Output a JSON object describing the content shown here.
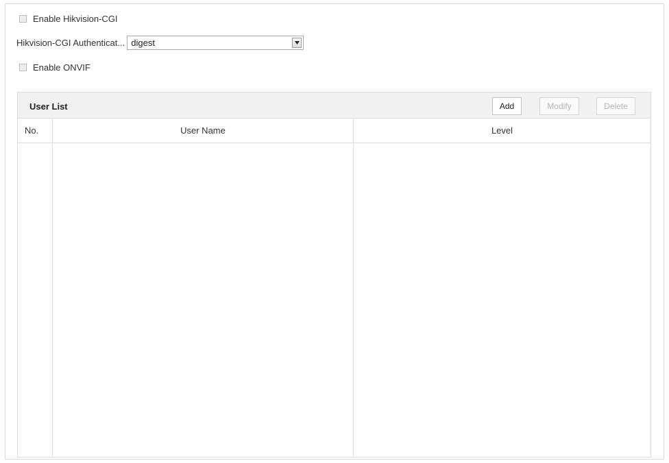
{
  "protocol": {
    "enable_cgi_label": "Enable Hikvision-CGI",
    "auth_label": "Hikvision-CGI Authenticat...",
    "auth_value": "digest",
    "enable_onvif_label": "Enable ONVIF"
  },
  "user_list": {
    "title": "User List",
    "add_label": "Add",
    "modify_label": "Modify",
    "delete_label": "Delete",
    "columns": [
      "No.",
      "User Name",
      "Level"
    ],
    "rows": []
  },
  "icons": {
    "dropdown": "chevron-down-icon"
  }
}
